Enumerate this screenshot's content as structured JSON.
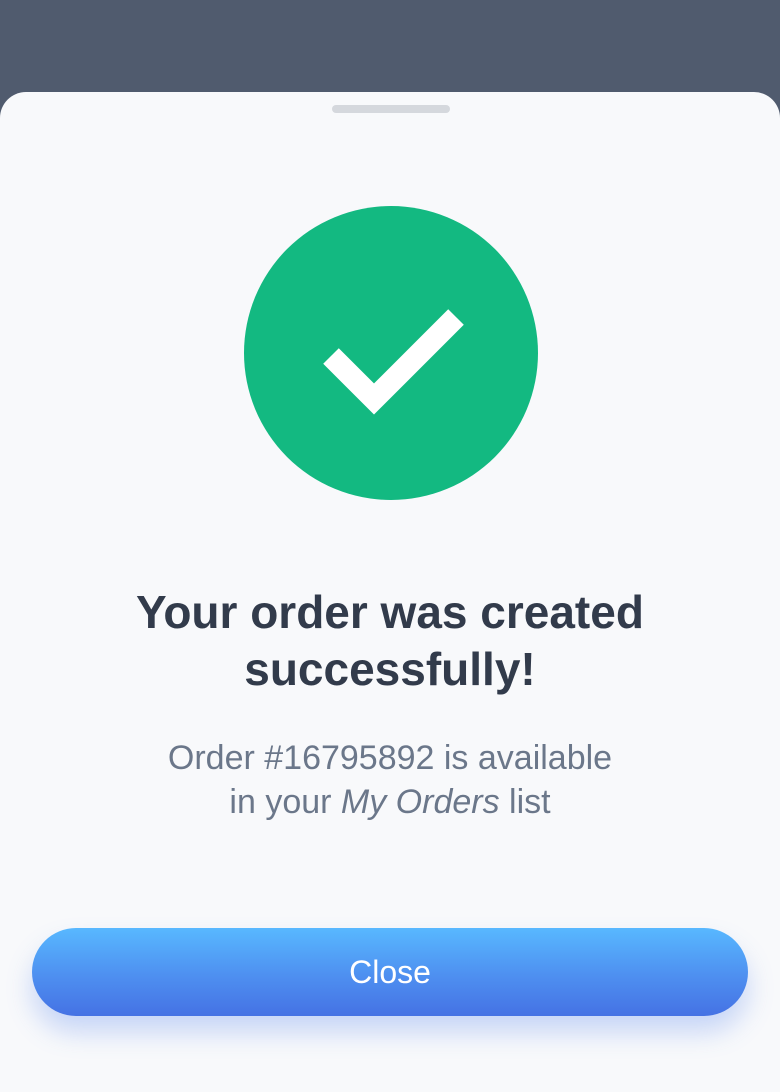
{
  "modal": {
    "title": "Your order was created successfully!",
    "message": {
      "prefix": "Order #16795892 is available",
      "line_two_start": "in your ",
      "emphasis": "My Orders",
      "suffix": " list"
    },
    "close_button_label": "Close"
  },
  "icons": {
    "success": "check-circle-icon"
  },
  "colors": {
    "backdrop": "#505b6e",
    "sheet_background": "#f8f9fb",
    "success": "#13b981",
    "title_text": "#323b4b",
    "body_text": "#6b778a",
    "button_gradient_start": "#58b8ff",
    "button_gradient_end": "#4572e4",
    "button_text": "#ffffff"
  }
}
